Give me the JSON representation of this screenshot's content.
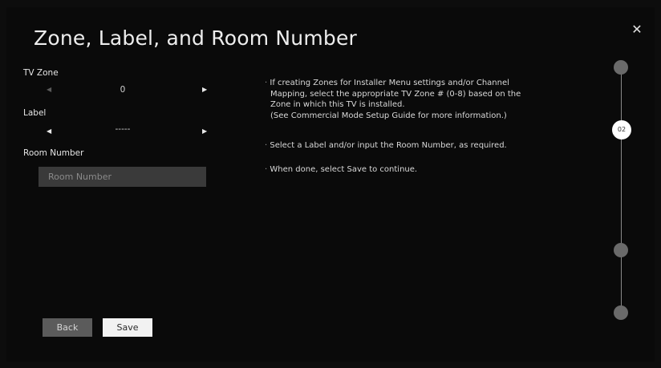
{
  "dialog": {
    "title": "Zone, Label, and Room Number",
    "close_label": "✕"
  },
  "tv_zone": {
    "label": "TV Zone",
    "value": "0",
    "left_arrow": "◀",
    "right_arrow": "▶"
  },
  "label_field": {
    "label": "Label",
    "value": "-----",
    "left_arrow": "◀",
    "right_arrow": "▶"
  },
  "room_number": {
    "label": "Room Number",
    "placeholder": "Room Number",
    "value": ""
  },
  "help": {
    "bullet1_line1": "If creating Zones for Installer Menu settings and/or Channel",
    "bullet1_line2": "Mapping, select the appropriate TV Zone # (0-8) based on the",
    "bullet1_line3": "Zone in which this TV is installed.",
    "bullet1_line4": "(See Commercial Mode Setup Guide for more information.)",
    "bullet2": "Select a Label and/or input the Room Number, as required.",
    "bullet3": "When done, select Save to continue.",
    "bullet_marker": "·"
  },
  "buttons": {
    "back_label": "Back",
    "save_label": "Save"
  },
  "progress": {
    "current_step_label": "02",
    "total_steps": 4,
    "current_step": 2
  }
}
